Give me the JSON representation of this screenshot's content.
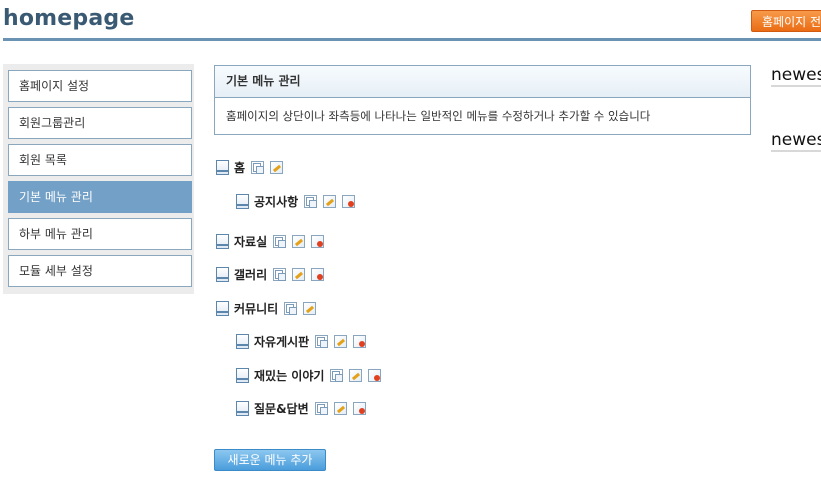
{
  "header": {
    "title": "homepage",
    "button_label": "홈페이지 전"
  },
  "sidebar": {
    "items": [
      {
        "label": "홈페이지 설정",
        "active": false
      },
      {
        "label": "회원그룹관리",
        "active": false
      },
      {
        "label": "회원 목록",
        "active": false
      },
      {
        "label": "기본 메뉴 관리",
        "active": true
      },
      {
        "label": "하부 메뉴 관리",
        "active": false
      },
      {
        "label": "모듈 세부 설정",
        "active": false
      }
    ]
  },
  "panel": {
    "title": "기본 메뉴 관리",
    "description": "홈페이지의 상단이나 좌측등에 나타나는 일반적인 메뉴를 수정하거나 추가할 수 있습니다"
  },
  "menu_tree": [
    {
      "label": "홈",
      "level": 0,
      "icons": [
        "copy-icon",
        "edit-icon"
      ]
    },
    {
      "label": "공지사항",
      "level": 1,
      "icons": [
        "copy-icon",
        "edit-icon",
        "delete-icon"
      ]
    },
    {
      "label": "자료실",
      "level": 0,
      "icons": [
        "copy-icon",
        "edit-icon",
        "delete-icon"
      ]
    },
    {
      "label": "갤러리",
      "level": 0,
      "icons": [
        "copy-icon",
        "edit-icon",
        "delete-icon"
      ]
    },
    {
      "label": "커뮤니티",
      "level": 0,
      "icons": [
        "copy-icon",
        "edit-icon"
      ]
    },
    {
      "label": "자유게시판",
      "level": 1,
      "icons": [
        "copy-icon",
        "edit-icon",
        "delete-icon"
      ]
    },
    {
      "label": "재밌는 이야기",
      "level": 1,
      "icons": [
        "copy-icon",
        "edit-icon",
        "delete-icon"
      ]
    },
    {
      "label": "질문&답변",
      "level": 1,
      "icons": [
        "copy-icon",
        "edit-icon",
        "delete-icon"
      ]
    }
  ],
  "add_button_label": "새로운 메뉴 추가",
  "right_widgets": [
    "newes",
    "newes"
  ],
  "colors": {
    "accent": "#6a92b2",
    "active_item": "#73a0c6",
    "orange_button": "#ea6c14",
    "blue_button": "#4a9ddb"
  }
}
